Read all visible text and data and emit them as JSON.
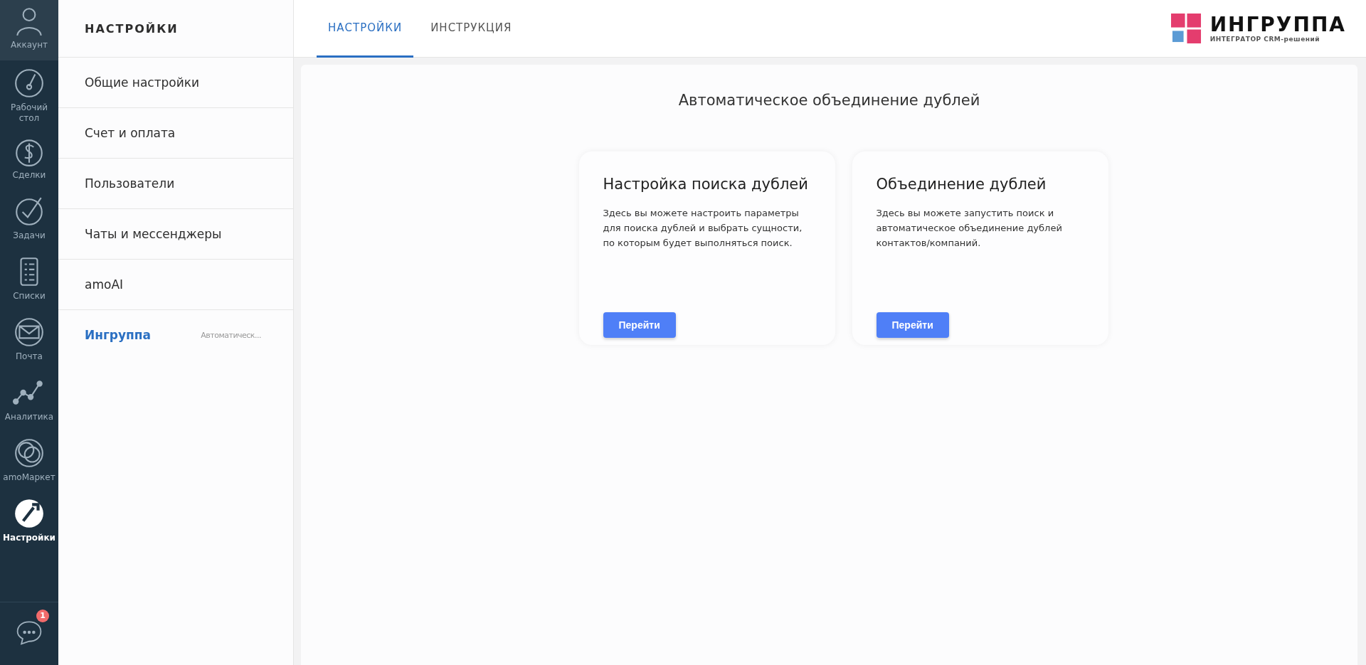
{
  "nav": {
    "items": [
      {
        "label": "Аккаунт",
        "selected": false
      },
      {
        "label": "Рабочий стол",
        "selected": false
      },
      {
        "label": "Сделки",
        "selected": false
      },
      {
        "label": "Задачи",
        "selected": false
      },
      {
        "label": "Списки",
        "selected": false
      },
      {
        "label": "Почта",
        "selected": false
      },
      {
        "label": "Аналитика",
        "selected": false
      },
      {
        "label": "amoМаркет",
        "selected": false
      },
      {
        "label": "Настройки",
        "selected": true
      }
    ],
    "chat_badge": "1"
  },
  "sidebar": {
    "title": "НАСТРОЙКИ",
    "items": [
      {
        "label": "Общие настройки",
        "selected": false
      },
      {
        "label": "Счет и оплата",
        "selected": false
      },
      {
        "label": "Пользователи",
        "selected": false
      },
      {
        "label": "Чаты и мессенджеры",
        "selected": false
      },
      {
        "label": "amoAI",
        "selected": false
      },
      {
        "label": "Ингруппа",
        "subtitle": "Автоматическ...",
        "selected": true
      }
    ]
  },
  "tabs": [
    {
      "label": "НАСТРОЙКИ",
      "selected": true
    },
    {
      "label": "ИНСТРУКЦИЯ",
      "selected": false
    }
  ],
  "logo": {
    "name": "ИНГРУППА",
    "tagline": "ИНТЕГРАТОР CRM-решений"
  },
  "page": {
    "title": "Автоматическое объединение дублей",
    "cards": [
      {
        "title": "Настройка поиска дублей",
        "text": "Здесь вы можете настроить параметры для поиска дублей и выбрать сущности, по которым будет выполняться поиск.",
        "button": "Перейти"
      },
      {
        "title": "Объединение дублей",
        "text": "Здесь вы можете запустить поиск и автоматическое объединение дублей контактов/компаний.",
        "button": "Перейти"
      }
    ]
  }
}
